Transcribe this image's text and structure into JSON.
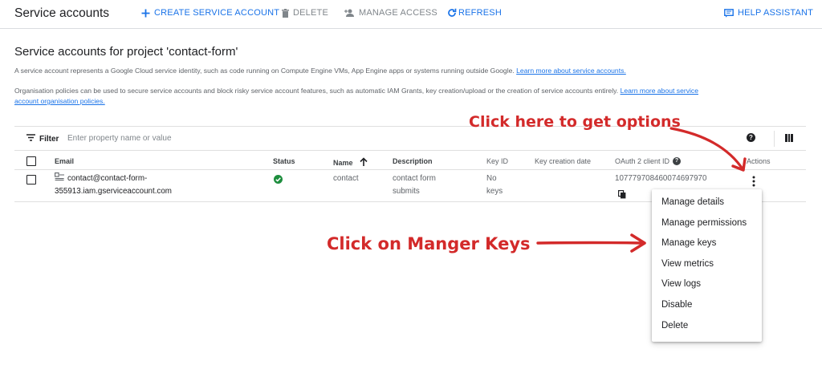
{
  "header": {
    "title": "Service accounts",
    "create_label": "CREATE SERVICE ACCOUNT",
    "delete_label": "DELETE",
    "manage_access_label": "MANAGE ACCESS",
    "refresh_label": "REFRESH",
    "help_label": "HELP ASSISTANT"
  },
  "page": {
    "title": "Service accounts for project 'contact-form'",
    "intro_text": "A service account represents a Google Cloud service identity, such as code running on Compute Engine VMs, App Engine apps or systems running outside Google.",
    "intro_link": "Learn more about service accounts.",
    "policy_text": "Organisation policies can be used to secure service accounts and block risky service account features, such as automatic IAM Grants, key creation/upload or the creation of service accounts entirely.",
    "policy_link_part1": "Learn more about service",
    "policy_link_part2": "account organisation policies."
  },
  "filter": {
    "label": "Filter",
    "placeholder": "Enter property name or value"
  },
  "table": {
    "columns": {
      "email": "Email",
      "status": "Status",
      "name": "Name",
      "description": "Description",
      "key_id": "Key ID",
      "key_date": "Key creation date",
      "oauth": "OAuth 2 client ID",
      "actions": "Actions"
    },
    "rows": [
      {
        "email_line1": "contact@contact-form-",
        "email_line2": "355913.iam.gserviceaccount.com",
        "status": "enabled",
        "name": "contact",
        "desc_line1": "contact form",
        "desc_line2": "submits",
        "key_line1": "No",
        "key_line2": "keys",
        "key_date": "",
        "oauth_id": "107779708460074697970"
      }
    ]
  },
  "menu": {
    "items": [
      "Manage details",
      "Manage permissions",
      "Manage keys",
      "View metrics",
      "View logs",
      "Disable",
      "Delete"
    ]
  },
  "annotations": {
    "top": "Click here to get options",
    "middle": "Click on Manger Keys"
  },
  "colors": {
    "accent": "#1a73e8",
    "annotation": "#d32a2a",
    "status_ok": "#1e8e3e"
  }
}
